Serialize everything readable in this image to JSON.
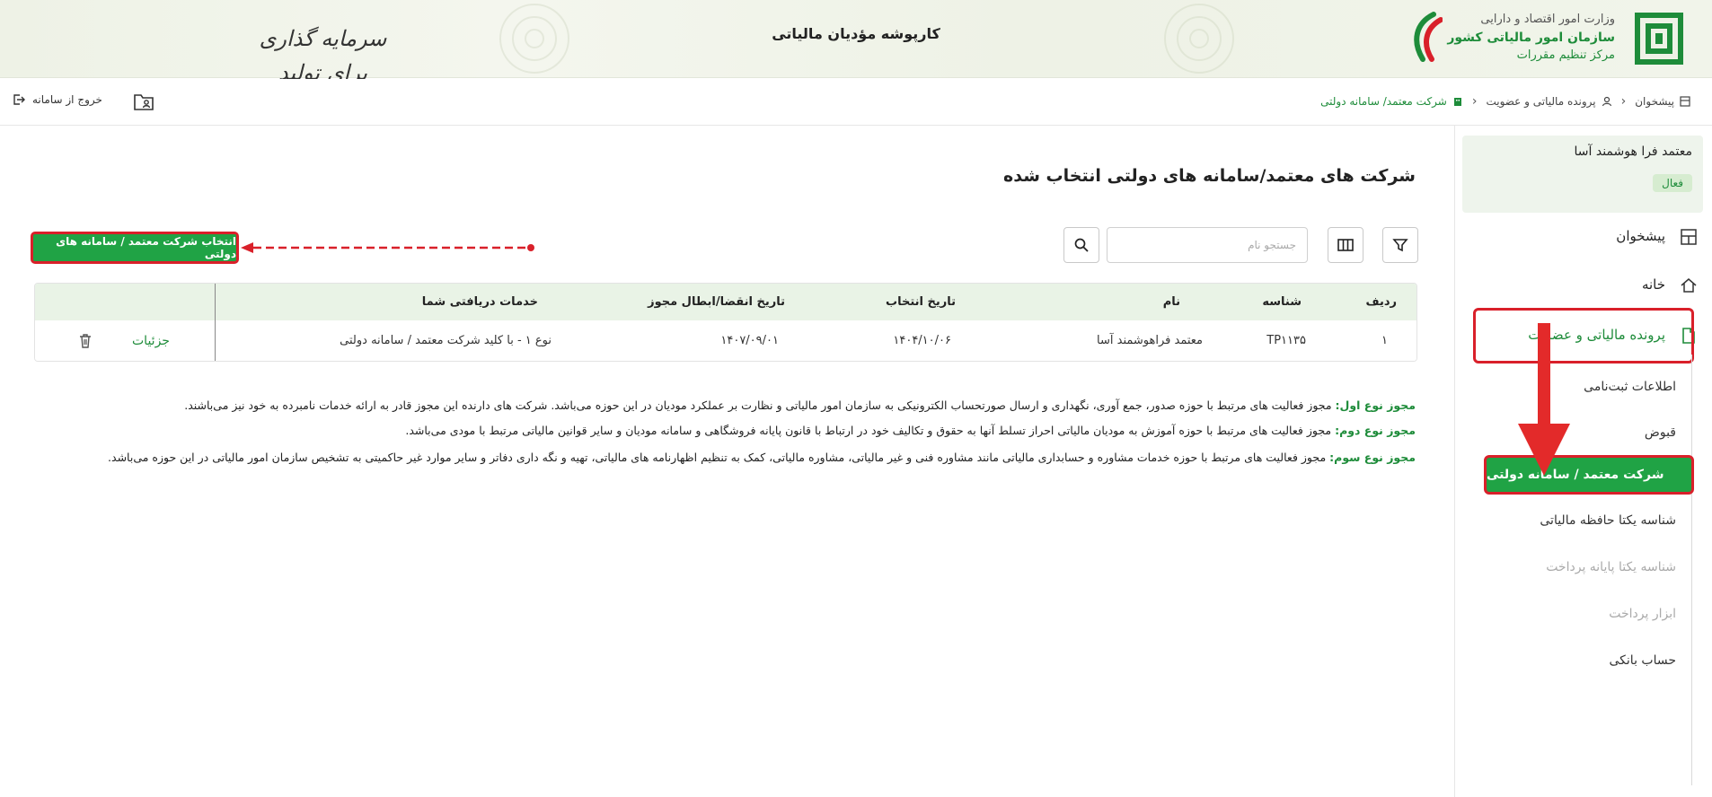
{
  "header": {
    "ministry": "وزارت امور اقتصاد و دارایی",
    "organization": "سازمان امور مالیاتی کشور",
    "department": "مرکز تنظیم مقررات",
    "portal_title": "کارپوشه مؤدیان مالیاتی",
    "slogan": "سرمایه گذاری برای تولید"
  },
  "topbar": {
    "exit_label": "خروج از سامانه",
    "breadcrumb": [
      "پیشخوان",
      "پرونده مالیاتی و عضویت",
      "شرکت معتمد/ سامانه دولتی"
    ]
  },
  "sidebar": {
    "user_name": "معتمد فرا هوشمند آسا",
    "status": "فعال",
    "items": [
      {
        "label": "پیشخوان",
        "icon": "dashboard-icon"
      },
      {
        "label": "خانه",
        "icon": "home-icon"
      },
      {
        "label": "پرونده مالیاتی و عضویت",
        "icon": "document-icon"
      }
    ],
    "sub_items": [
      {
        "label": "اطلاعات ثبت‌نامی",
        "disabled": false
      },
      {
        "label": "قبوض",
        "disabled": false
      },
      {
        "label": "شرکت معتمد / سامانه دولتی",
        "disabled": false,
        "active": true
      },
      {
        "label": "شناسه یکتا حافظه مالیاتی",
        "disabled": false
      },
      {
        "label": "شناسه یکتا پایانه پرداخت",
        "disabled": true
      },
      {
        "label": "ابزار پرداخت",
        "disabled": true
      },
      {
        "label": "حساب بانکی",
        "disabled": false
      }
    ]
  },
  "main": {
    "heading": "شرکت های معتمد/سامانه های دولتی انتخاب شده",
    "search_placeholder": "جستجو نام",
    "select_button": "انتخاب شرکت معتمد / سامانه های دولتی",
    "table": {
      "columns": [
        "ردیف",
        "شناسه",
        "نام",
        "تاریخ انتخاب",
        "تاریخ انقضا/ابطال مجوز",
        "خدمات دریافتی شما"
      ],
      "rows": [
        {
          "row": "۱",
          "id": "TP۱۱۳۵",
          "name": "معتمد فراهوشمند آسا",
          "select_date": "۱۴۰۴/۱۰/۰۶",
          "expiry": "۱۴۰۷/۰۹/۰۱",
          "service": "نوع ۱ - با کلید شرکت معتمد / سامانه دولتی",
          "details": "جزئیات"
        }
      ]
    },
    "descriptions": [
      {
        "label": "مجوز نوع اول:",
        "text": "مجوز فعالیت های مرتبط با حوزه صدور، جمع آوری، نگهداری و ارسال صورتحساب الکترونیکی به سازمان امور مالیاتی و نظارت بر عملکرد مودیان در این حوزه می‌باشد. شرکت های دارنده این مجوز قادر به ارائه خدمات نامبرده به خود نیز می‌باشند."
      },
      {
        "label": "مجوز نوع دوم:",
        "text": "مجوز فعالیت های مرتبط با حوزه آموزش به مودیان مالیاتی احراز تسلط آنها به حقوق و تکالیف خود در ارتباط با قانون پایانه فروشگاهی و سامانه مودیان و سایر قوانین مالیاتی مرتبط با مودی می‌باشد."
      },
      {
        "label": "مجوز نوع سوم:",
        "text": "مجوز فعالیت های مرتبط با حوزه خدمات مشاوره و حسابداری مالیاتی مانند مشاوره فنی و غیر مالیاتی، مشاوره مالیاتی، کمک به تنظیم اظهارنامه های مالیاتی، تهیه و نگه داری دفاتر و سایر موارد غیر حاکمیتی به تشخیص سازمان امور مالیاتی در این حوزه می‌باشد."
      }
    ]
  },
  "colors": {
    "brand_green": "#20a345",
    "text_green": "#1e8c3a",
    "highlight_red": "#d9202a"
  }
}
